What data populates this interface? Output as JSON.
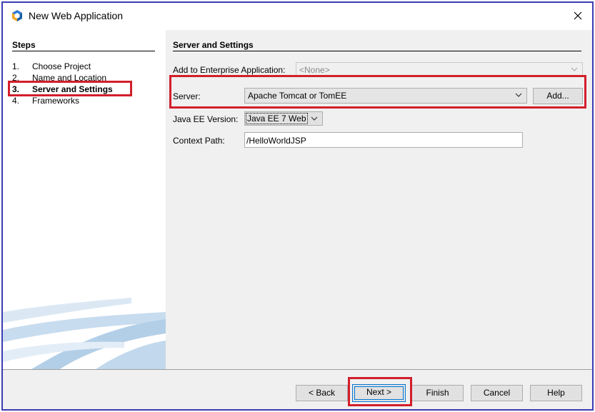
{
  "window": {
    "title": "New Web Application",
    "close_icon": "close-icon",
    "app_icon": "netbeans-icon"
  },
  "steps": {
    "title": "Steps",
    "items": [
      {
        "num": "1.",
        "label": "Choose Project"
      },
      {
        "num": "2.",
        "label": "Name and Location"
      },
      {
        "num": "3.",
        "label": "Server and Settings",
        "current": true
      },
      {
        "num": "4.",
        "label": "Frameworks"
      }
    ]
  },
  "panel": {
    "title": "Server and Settings",
    "enterprise_label": "Add to Enterprise Application:",
    "enterprise_value": "<None>",
    "server_label": "Server:",
    "server_value": "Apache Tomcat or TomEE",
    "add_button": "Add...",
    "javaee_label": "Java EE Version:",
    "javaee_value": "Java EE 7 Web",
    "context_label": "Context Path:",
    "context_value": "/HelloWorldJSP"
  },
  "buttons": {
    "back": "< Back",
    "next": "Next >",
    "finish": "Finish",
    "cancel": "Cancel",
    "help": "Help"
  },
  "colors": {
    "highlight": "#d21f2b",
    "frame_border": "#3c3cb4",
    "default_button_border": "#0078d7",
    "panel_bg": "#f0f0f0"
  }
}
